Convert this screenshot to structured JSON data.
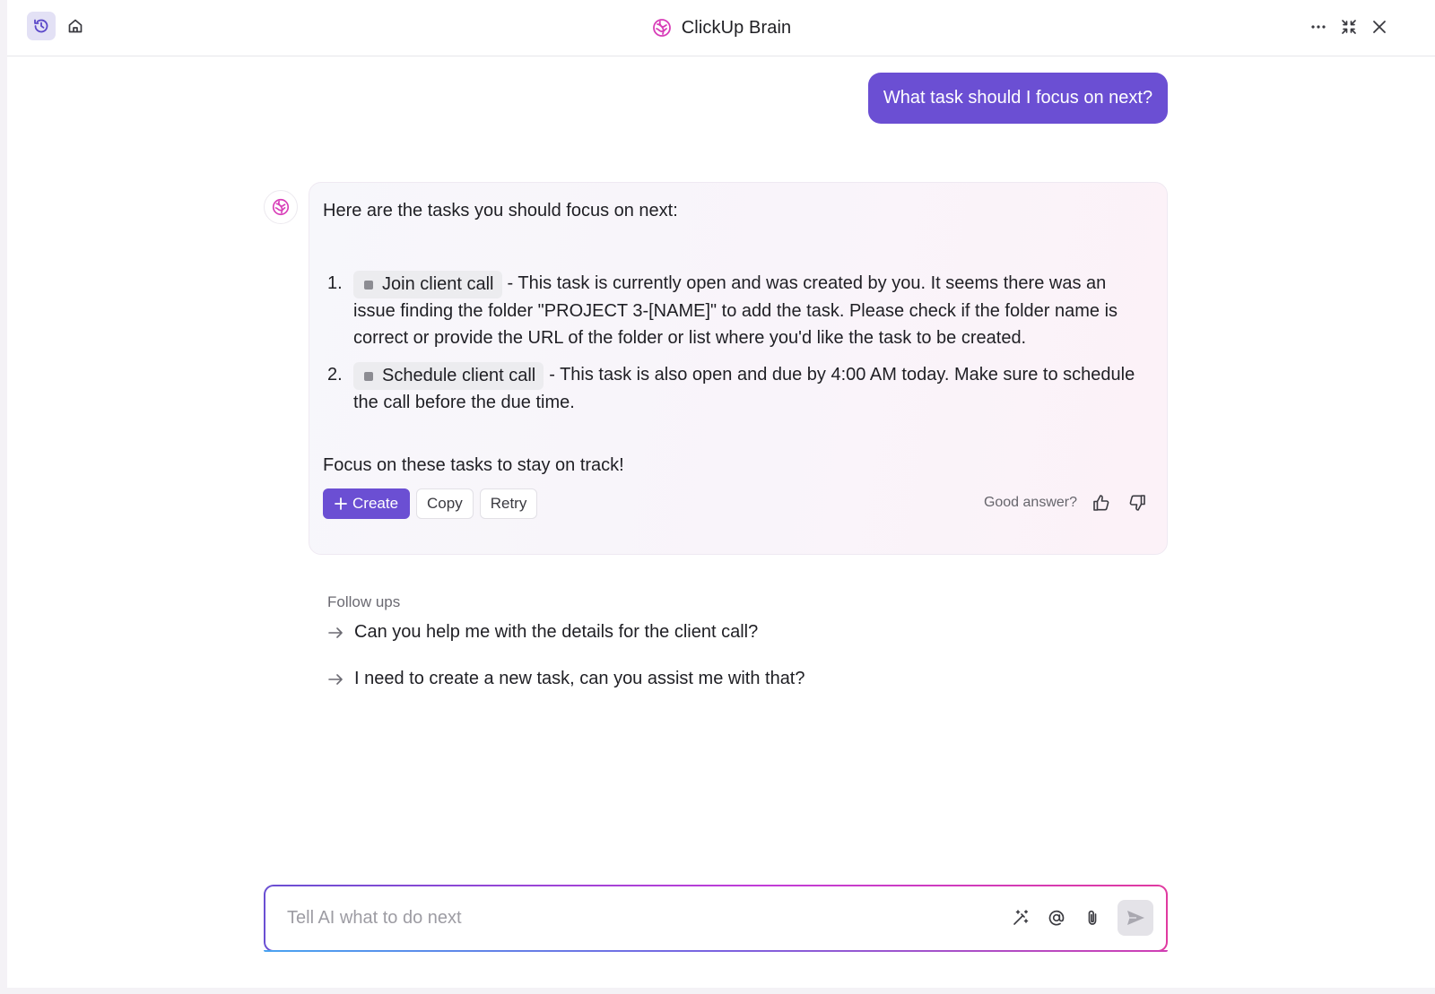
{
  "app": {
    "title": "ClickUp Brain"
  },
  "colors": {
    "accent": "#6b4fd3",
    "brand_pink": "#d93fb6",
    "chip_bg": "#ececef"
  },
  "header": {
    "left_icons": [
      "history-icon",
      "home-icon"
    ],
    "right_icons": [
      "more-icon",
      "collapse-icon",
      "close-icon"
    ]
  },
  "conversation": {
    "user_message": "What task should I focus on next?",
    "answer": {
      "intro": "Here are the tasks you should focus on next:",
      "tasks": [
        {
          "number": "1.",
          "task_name": "Join client call",
          "description": "- This task is currently open and was created by you. It seems there was an issue finding the folder \"PROJECT 3-[NAME]\" to add the task. Please check if the folder name is correct or provide the URL of the folder or list where you'd like the task to be created."
        },
        {
          "number": "2.",
          "task_name": "Schedule client call",
          "description": "- This task is also open and due by 4:00 AM today. Make sure to schedule the call before the due time."
        }
      ],
      "outro": "Focus on these tasks to stay on track!",
      "actions": {
        "create": "Create",
        "copy": "Copy",
        "retry": "Retry"
      },
      "feedback_label": "Good answer?"
    }
  },
  "followups": {
    "title": "Follow ups",
    "items": [
      "Can you help me with the details for the client call?",
      "I need to create a new task, can you assist me with that?"
    ]
  },
  "composer": {
    "placeholder": "Tell AI what to do next",
    "value": ""
  }
}
